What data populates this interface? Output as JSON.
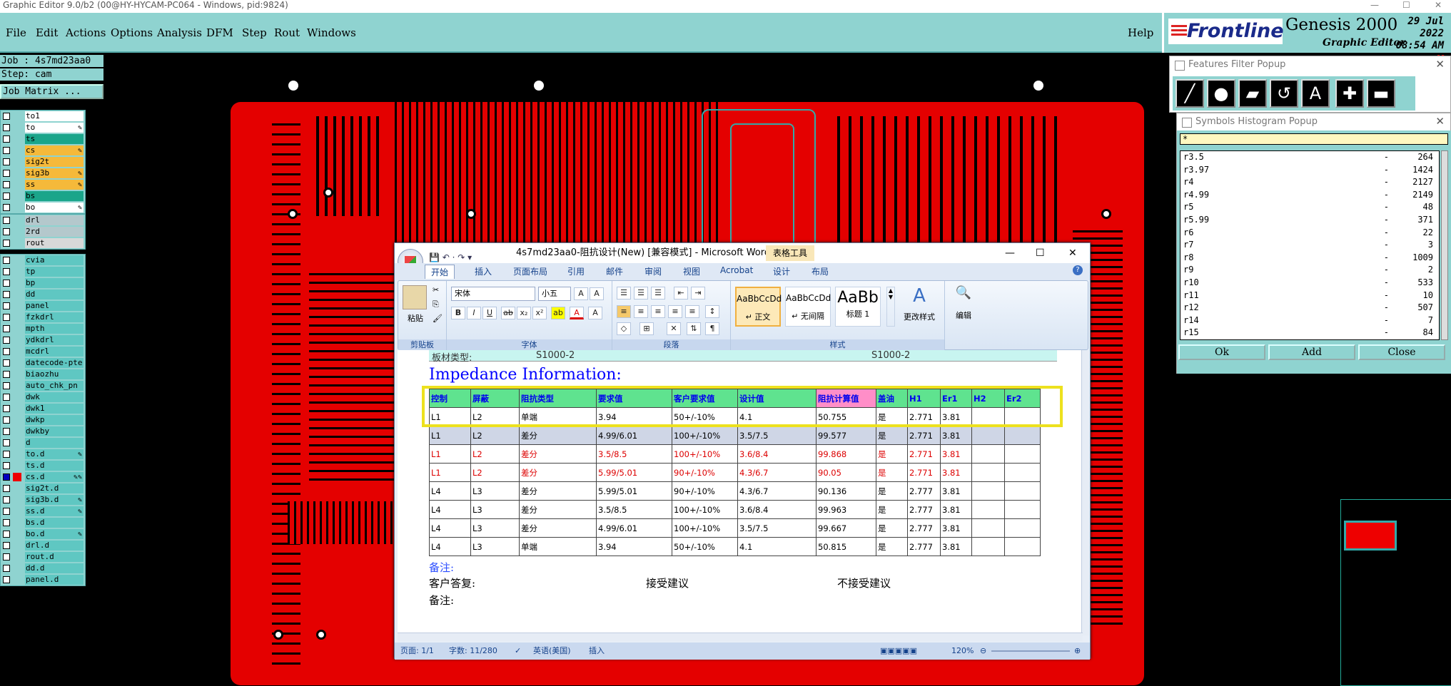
{
  "window": {
    "title": "Graphic Editor 9.0/b2 (00@HY-HYCAM-PC064 - Windows, pid:9824)"
  },
  "menu": [
    "File",
    "Edit",
    "Actions",
    "Options",
    "Analysis",
    "DFM",
    "Step",
    "Rout",
    "Windows",
    "Help"
  ],
  "brand": {
    "logo": "Frontline",
    "product": "Genesis 2000",
    "sub": "Graphic Editor",
    "date": "29 Jul 2022",
    "time": "08:54 AM"
  },
  "job": {
    "job_line": "Job : 4s7md23aa0",
    "step_line": "Step: cam",
    "matrix_button": "Job Matrix ..."
  },
  "layers_a": [
    {
      "name": "to1",
      "color": "#ffffff",
      "mark": ""
    },
    {
      "name": "to",
      "color": "#ffffff",
      "mark": "✎"
    },
    {
      "name": "ts",
      "color": "#1aa58a",
      "mark": ""
    },
    {
      "name": "cs",
      "color": "#f5b93a",
      "mark": "✎"
    },
    {
      "name": "sig2t",
      "color": "#f5b93a",
      "mark": ""
    },
    {
      "name": "sig3b",
      "color": "#f5b93a",
      "mark": "✎"
    },
    {
      "name": "ss",
      "color": "#f5b93a",
      "mark": "✎"
    },
    {
      "name": "bs",
      "color": "#1aa58a",
      "mark": ""
    },
    {
      "name": "bo",
      "color": "#ffffff",
      "mark": "✎"
    }
  ],
  "layers_b": [
    {
      "name": "drl",
      "color": "#b4c8cc",
      "mark": ""
    },
    {
      "name": "2rd",
      "color": "#b4c8cc",
      "mark": ""
    },
    {
      "name": "rout",
      "color": "#d8d8d8",
      "mark": ""
    }
  ],
  "layers_c": [
    {
      "name": "cvia",
      "mark": ""
    },
    {
      "name": "tp",
      "mark": ""
    },
    {
      "name": "bp",
      "mark": ""
    },
    {
      "name": "dd",
      "mark": ""
    },
    {
      "name": "panel",
      "mark": ""
    },
    {
      "name": "fzkdrl",
      "mark": ""
    },
    {
      "name": "mpth",
      "mark": ""
    },
    {
      "name": "ydkdrl",
      "mark": ""
    },
    {
      "name": "mcdrl",
      "mark": ""
    },
    {
      "name": "datecode-pte",
      "mark": ""
    },
    {
      "name": "biaozhu",
      "mark": ""
    },
    {
      "name": "auto_chk_pn",
      "mark": ""
    },
    {
      "name": "dwk",
      "mark": ""
    },
    {
      "name": "dwk1",
      "mark": ""
    },
    {
      "name": "dwkp",
      "mark": ""
    },
    {
      "name": "dwkby",
      "mark": ""
    },
    {
      "name": "d",
      "mark": ""
    },
    {
      "name": "to.d",
      "mark": "✎"
    },
    {
      "name": "ts.d",
      "mark": ""
    },
    {
      "name": "cs.d",
      "mark": "✎✎",
      "active": true
    },
    {
      "name": "sig2t.d",
      "mark": ""
    },
    {
      "name": "sig3b.d",
      "mark": "✎"
    },
    {
      "name": "ss.d",
      "mark": "✎"
    },
    {
      "name": "bs.d",
      "mark": ""
    },
    {
      "name": "bo.d",
      "mark": "✎"
    },
    {
      "name": "drl.d",
      "mark": ""
    },
    {
      "name": "rout.d",
      "mark": ""
    },
    {
      "name": "dd.d",
      "mark": ""
    },
    {
      "name": "panel.d",
      "mark": ""
    }
  ],
  "word": {
    "title": "4s7md23aa0-阻抗设计(New) [兼容模式] - Microsoft Word",
    "context_tab": "表格工具",
    "tabs": [
      "开始",
      "插入",
      "页面布局",
      "引用",
      "邮件",
      "审阅",
      "视图",
      "Acrobat",
      "设计",
      "布局"
    ],
    "ribbon": {
      "paste": "粘贴",
      "clipboard": "剪贴板",
      "font_name": "宋体",
      "font_size": "小五",
      "font_group": "字体",
      "para_group": "段落",
      "styles_group": "样式",
      "styles": [
        {
          "sample": "AaBbCcDd",
          "name": "↵ 正文"
        },
        {
          "sample": "AaBbCcDd",
          "name": "↵ 无间隔"
        },
        {
          "sample": "AaBb",
          "name": "标题 1"
        }
      ],
      "change_styles": "更改样式",
      "edit": "编辑"
    },
    "doc": {
      "top_row": [
        "板材类型:",
        "S1000-2",
        "S1000-2"
      ],
      "heading": "Impedance Information:",
      "headers": [
        "控制",
        "屏蔽",
        "阻抗类型",
        "要求值",
        "客户要求值",
        "设计值",
        "阻抗计算值",
        "盖油",
        "H1",
        "Er1",
        "H2",
        "Er2"
      ],
      "rows": [
        {
          "style": "",
          "cells": [
            "L1",
            "L2",
            "单端",
            "3.94",
            "50+/-10%",
            "4.1",
            "50.755",
            "是",
            "2.771",
            "3.81",
            "",
            ""
          ]
        },
        {
          "style": "sel",
          "cells": [
            "L1",
            "L2",
            "差分",
            "4.99/6.01",
            "100+/-10%",
            "3.5/7.5",
            "99.577",
            "是",
            "2.771",
            "3.81",
            "",
            ""
          ]
        },
        {
          "style": "red",
          "cells": [
            "L1",
            "L2",
            "差分",
            "3.5/8.5",
            "100+/-10%",
            "3.6/8.4",
            "99.868",
            "是",
            "2.771",
            "3.81",
            "",
            ""
          ]
        },
        {
          "style": "red",
          "cells": [
            "L1",
            "L2",
            "差分",
            "5.99/5.01",
            "90+/-10%",
            "4.3/6.7",
            "90.05",
            "是",
            "2.771",
            "3.81",
            "",
            ""
          ]
        },
        {
          "style": "",
          "cells": [
            "L4",
            "L3",
            "差分",
            "5.99/5.01",
            "90+/-10%",
            "4.3/6.7",
            "90.136",
            "是",
            "2.777",
            "3.81",
            "",
            ""
          ]
        },
        {
          "style": "",
          "cells": [
            "L4",
            "L3",
            "差分",
            "3.5/8.5",
            "100+/-10%",
            "3.6/8.4",
            "99.963",
            "是",
            "2.777",
            "3.81",
            "",
            ""
          ]
        },
        {
          "style": "",
          "cells": [
            "L4",
            "L3",
            "差分",
            "4.99/6.01",
            "100+/-10%",
            "3.5/7.5",
            "99.667",
            "是",
            "2.777",
            "3.81",
            "",
            ""
          ]
        },
        {
          "style": "",
          "cells": [
            "L4",
            "L3",
            "单端",
            "3.94",
            "50+/-10%",
            "4.1",
            "50.815",
            "是",
            "2.777",
            "3.81",
            "",
            ""
          ]
        }
      ],
      "note1": "备注:",
      "reply_label": "客户答复:",
      "accept": "接受建议",
      "reject": "不接受建议",
      "note2": "备注:"
    },
    "status": {
      "page": "页面: 1/1",
      "words": "字数: 11/280",
      "lang": "英语(美国)",
      "mode": "插入",
      "zoom": "120%"
    }
  },
  "features_filter": {
    "title": "Features Filter Popup",
    "tools": [
      "line",
      "pad",
      "surface",
      "arc",
      "text",
      "plus",
      "minus"
    ]
  },
  "symbols_histogram": {
    "title": "Symbols Histogram Popup",
    "filter": "*",
    "items": [
      {
        "sym": "r3.5",
        "count": "264"
      },
      {
        "sym": "r3.97",
        "count": "1424"
      },
      {
        "sym": "r4",
        "count": "2127"
      },
      {
        "sym": "r4.99",
        "count": "2149"
      },
      {
        "sym": "r5",
        "count": "48"
      },
      {
        "sym": "r5.99",
        "count": "371"
      },
      {
        "sym": "r6",
        "count": "22"
      },
      {
        "sym": "r7",
        "count": "3"
      },
      {
        "sym": "r8",
        "count": "1009"
      },
      {
        "sym": "r9",
        "count": "2"
      },
      {
        "sym": "r10",
        "count": "533"
      },
      {
        "sym": "r11",
        "count": "10"
      },
      {
        "sym": "r12",
        "count": "507"
      },
      {
        "sym": "r14",
        "count": "7"
      },
      {
        "sym": "r15",
        "count": "84"
      }
    ],
    "buttons": [
      "Ok",
      "Add",
      "Close"
    ]
  }
}
